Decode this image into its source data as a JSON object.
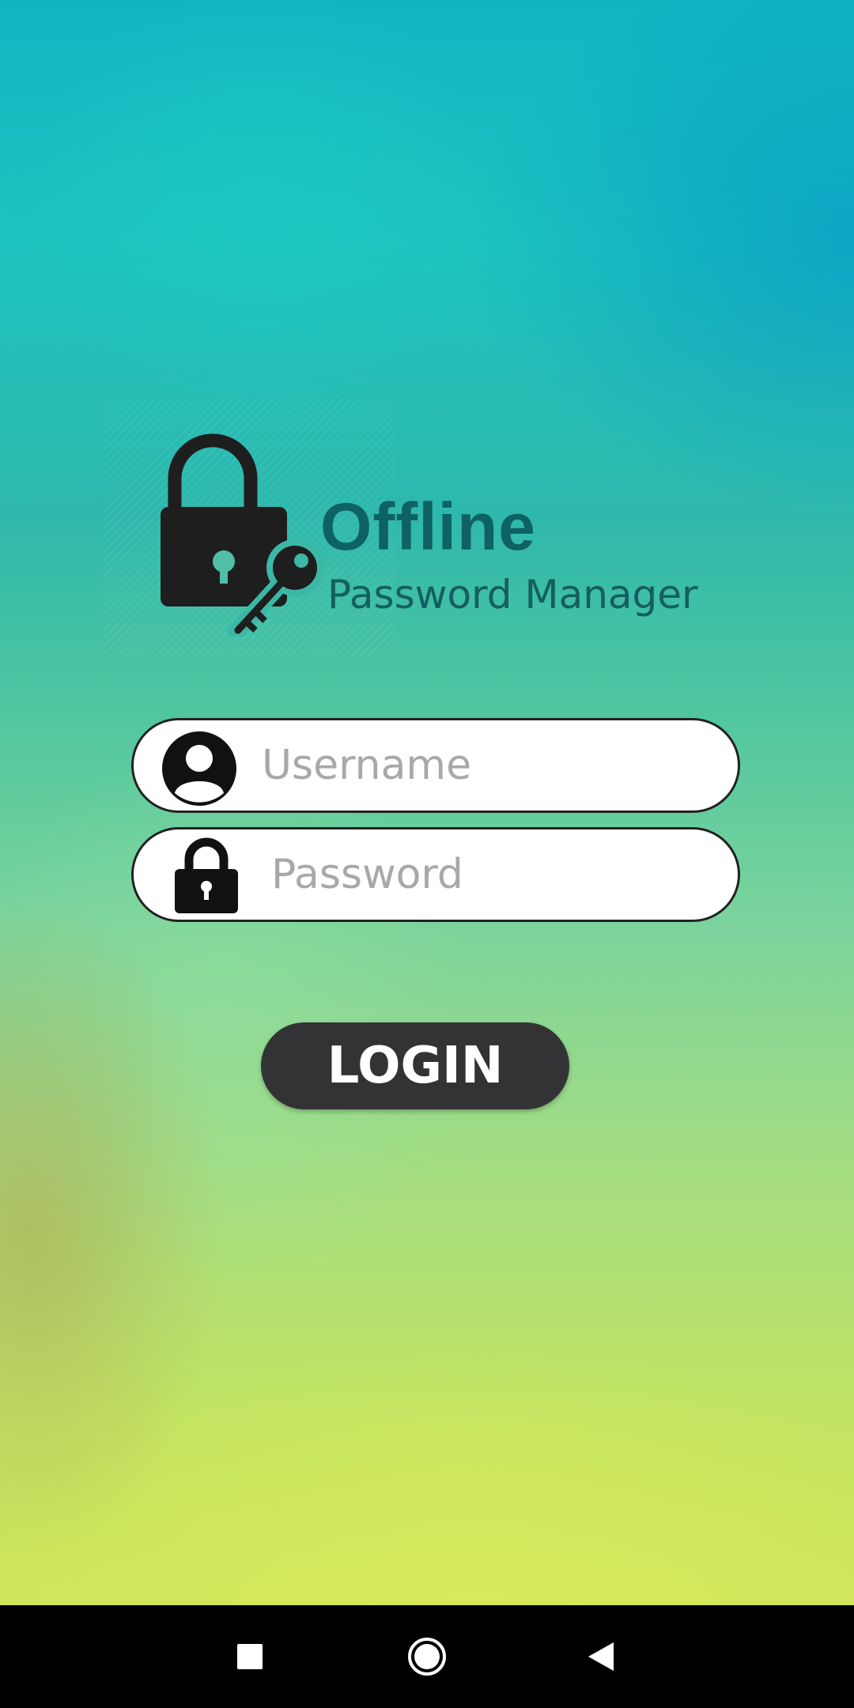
{
  "app": {
    "title": "Offline",
    "subtitle": "Password Manager"
  },
  "form": {
    "username_placeholder": "Username",
    "password_placeholder": "Password",
    "login_label": "LOGIN"
  },
  "icons": {
    "logo": "lock-and-key-icon",
    "username": "user-avatar-icon",
    "password": "padlock-icon",
    "nav_recents": "square-icon",
    "nav_home": "circle-icon",
    "nav_back": "triangle-back-icon"
  },
  "colors": {
    "title": "#0f6264",
    "subtitle": "#155e61",
    "button": "#333335",
    "icon": "#1e1e1e"
  }
}
